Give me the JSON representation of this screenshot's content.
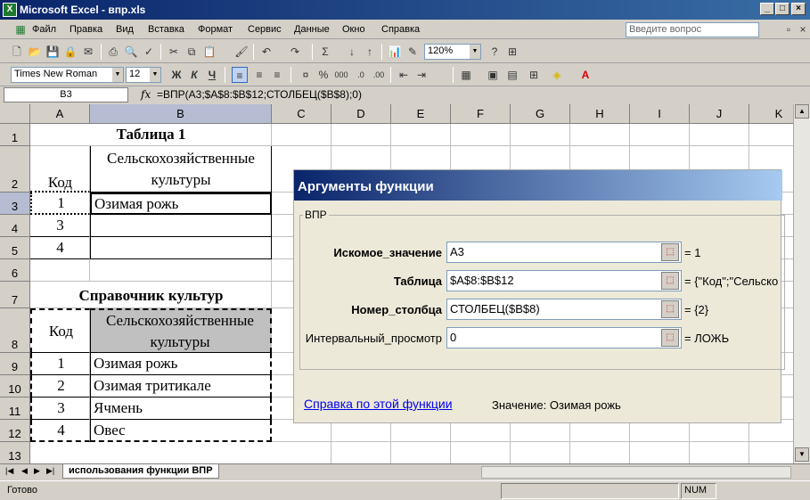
{
  "window": {
    "title": "Microsoft Excel - впр.xls",
    "app_icon": "excel-icon"
  },
  "menu": {
    "items": [
      "Файл",
      "Правка",
      "Вид",
      "Вставка",
      "Формат",
      "Сервис",
      "Данные",
      "Окно",
      "Справка"
    ],
    "help_placeholder": "Введите вопрос"
  },
  "toolbar": {
    "zoom": "120%",
    "font_name": "Times New Roman",
    "font_size": "12",
    "bold_label": "Ж",
    "italic_label": "К",
    "underline_label": "Ч",
    "percent_label": "%",
    "thousands_label": "000"
  },
  "formula_bar": {
    "name_box": "B3",
    "fx": "fx",
    "formula": "=ВПР(A3;$A$8:$B$12;СТОЛБЕЦ($B$8);0)"
  },
  "sheet": {
    "columns": [
      "A",
      "B",
      "C",
      "D",
      "E",
      "F",
      "G",
      "H",
      "I",
      "J",
      "K"
    ],
    "rows": [
      "1",
      "2",
      "3",
      "4",
      "5",
      "6",
      "7",
      "8",
      "9",
      "10",
      "11",
      "12",
      "13"
    ],
    "title1": "Таблица 1",
    "a2": "Код",
    "b2_line1": "Сельскохозяйственные",
    "b2_line2": "культуры",
    "a3": "1",
    "b3": "Озимая рожь",
    "a4": "3",
    "a5": "4",
    "title2": "Справочник культур",
    "a8": "Код",
    "b8_line1": "Сельскохозяйственные",
    "b8_line2": "культуры",
    "ref_rows": [
      {
        "code": "1",
        "crop": "Озимая рожь"
      },
      {
        "code": "2",
        "crop": "Озимая тритикале"
      },
      {
        "code": "3",
        "crop": "Ячмень"
      },
      {
        "code": "4",
        "crop": "Овес"
      }
    ]
  },
  "dialog": {
    "title": "Аргументы функции",
    "group": "ВПР",
    "args": [
      {
        "label": "Искомое_значение",
        "value": "A3",
        "result": "= 1"
      },
      {
        "label": "Таблица",
        "value": "$A$8:$B$12",
        "result": "= {\"Код\";\"Сельско"
      },
      {
        "label": "Номер_столбца",
        "value": "СТОЛБЕЦ($B$8)",
        "result": "= {2}"
      },
      {
        "label": "Интервальный_просмотр",
        "value": "0",
        "result": "= ЛОЖЬ"
      }
    ],
    "help_link": "Справка по этой функции",
    "value_label": "Значение:",
    "value": "Озимая рожь"
  },
  "tabs": {
    "sheet_name": "использования функции ВПР"
  },
  "status": {
    "text": "Готово",
    "num": "NUM"
  }
}
